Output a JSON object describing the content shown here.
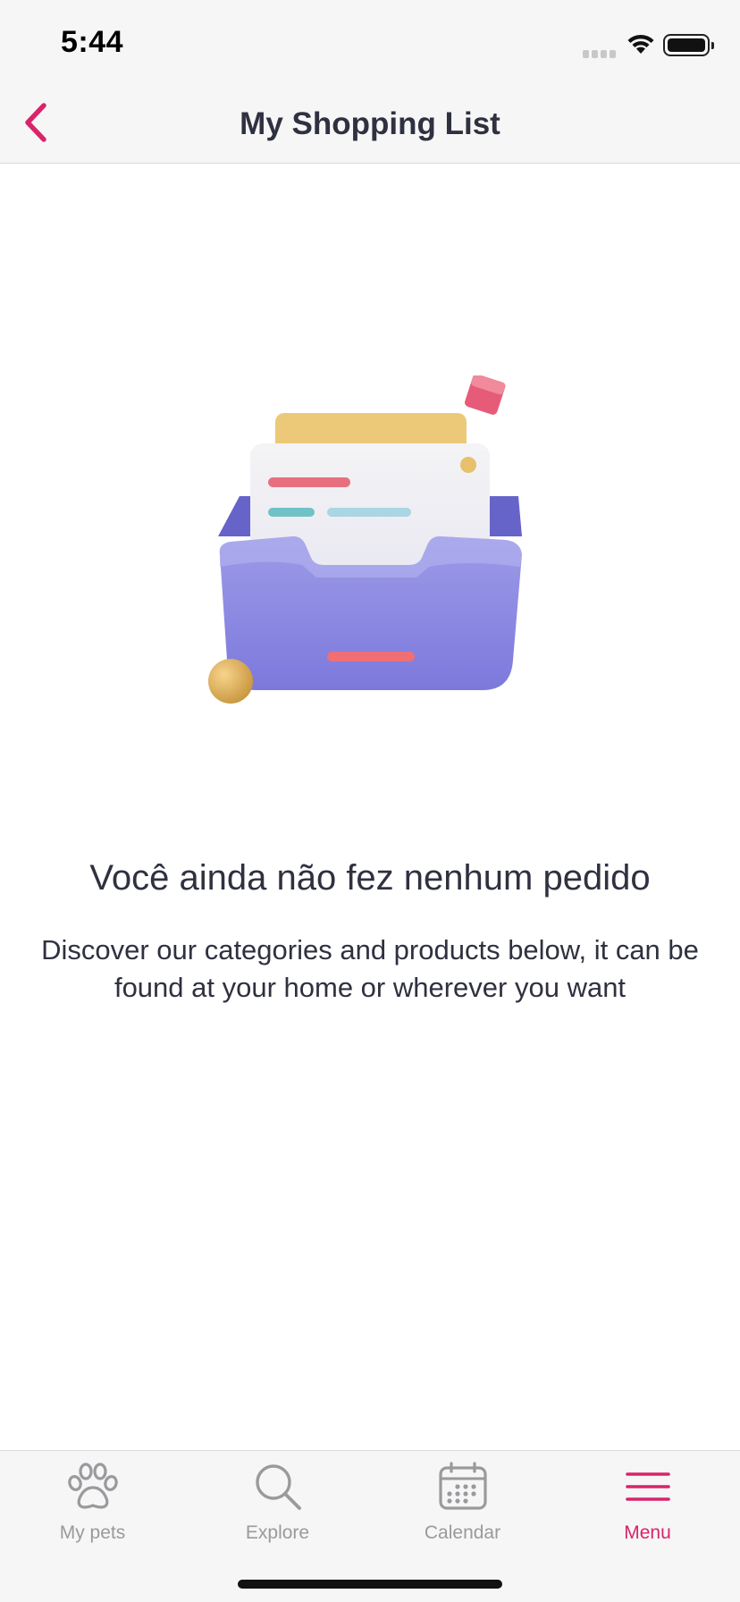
{
  "status_bar": {
    "time": "5:44"
  },
  "header": {
    "title": "My Shopping List",
    "back_icon": "chevron-left-icon"
  },
  "empty_state": {
    "illustration": "empty-inbox-tray-illustration",
    "title": "Você ainda não fez nenhum pedido",
    "description": "Discover our categories and products below, it can be found at your home or wherever you want"
  },
  "tab_bar": {
    "active_tab": "Menu",
    "items": [
      {
        "label": "My pets",
        "icon": "paw-icon"
      },
      {
        "label": "Explore",
        "icon": "search-icon"
      },
      {
        "label": "Calendar",
        "icon": "calendar-icon"
      },
      {
        "label": "Menu",
        "icon": "hamburger-menu-icon"
      }
    ]
  },
  "colors": {
    "accent": "#d8246b",
    "text": "#2f3140",
    "inactive_tab": "#9a9a9e",
    "bar_background": "#f6f6f6"
  }
}
